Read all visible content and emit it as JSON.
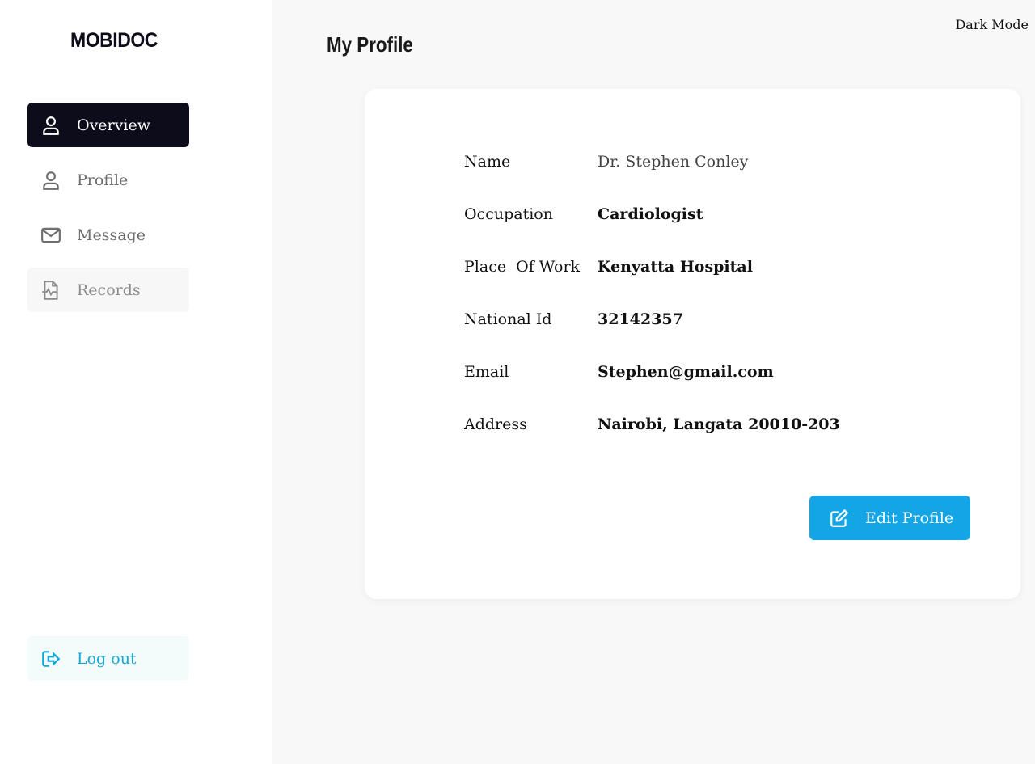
{
  "brand": "MOBIDOC",
  "header": {
    "dark_mode_label": "Dark Mode",
    "page_title": "My Profile"
  },
  "sidebar": {
    "items": [
      {
        "label": "Overview",
        "icon": "user-icon",
        "active": true
      },
      {
        "label": "Profile",
        "icon": "user-icon"
      },
      {
        "label": "Message",
        "icon": "envelope-icon"
      },
      {
        "label": "Records",
        "icon": "file-pulse-icon"
      }
    ],
    "logout": {
      "label": "Log out",
      "icon": "logout-icon"
    }
  },
  "profile": {
    "fields": [
      {
        "label": "Name",
        "value": "Dr. Stephen Conley"
      },
      {
        "label": "Occupation",
        "value": "Cardiologist"
      },
      {
        "label": "Place  Of Work",
        "value": "Kenyatta Hospital"
      },
      {
        "label": "National Id",
        "value": "32142357"
      },
      {
        "label": "Email",
        "value": "Stephen@gmail.com"
      },
      {
        "label": "Address",
        "value": "Nairobi, Langata 20010-203"
      }
    ],
    "edit_label": "Edit Profile"
  },
  "colors": {
    "dark": "#0c0c1a",
    "accent": "#13a5e6",
    "logout": "#13a8d8",
    "background": "#f8f8f8"
  }
}
